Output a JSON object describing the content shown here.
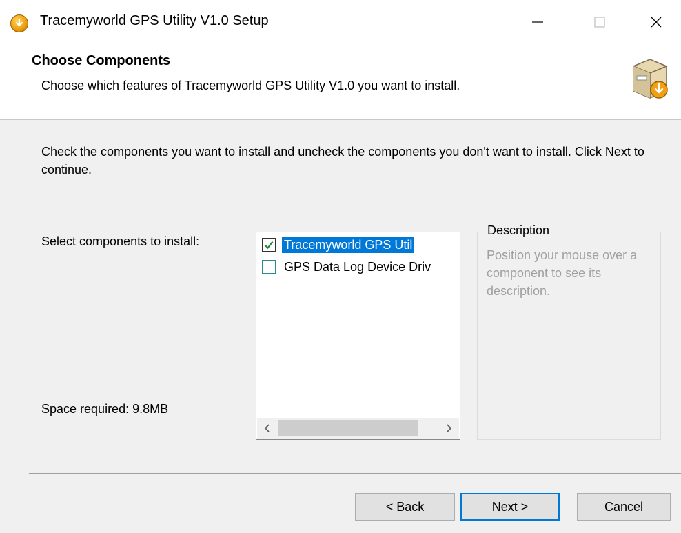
{
  "window": {
    "title": "Tracemyworld GPS Utility V1.0 Setup",
    "icon": "installer-icon",
    "controls": {
      "minimize": "minimize-icon",
      "maximize": "maximize-icon",
      "close": "close-icon"
    }
  },
  "header": {
    "title": "Choose Components",
    "subtitle": "Choose which features of Tracemyworld GPS Utility V1.0 you want to install.",
    "icon": "install-box-icon"
  },
  "body": {
    "instructions": "Check the components you want to install and uncheck the components you don't want to install. Click Next to continue.",
    "select_label": "Select components to install:",
    "space_required": "Space required: 9.8MB"
  },
  "components": [
    {
      "label": "Tracemyworld GPS Util",
      "checked": true,
      "selected": true
    },
    {
      "label": "GPS Data Log Device Driv",
      "checked": false,
      "selected": false
    }
  ],
  "scrollbar": {
    "left_arrow": "chevron-left-icon",
    "right_arrow": "chevron-right-icon"
  },
  "description": {
    "legend": "Description",
    "text": "Position your mouse over a component to see its description."
  },
  "buttons": {
    "back": "< Back",
    "next": "Next >",
    "cancel": "Cancel"
  },
  "colors": {
    "selection": "#0078d7",
    "default_button_border": "#0078d7",
    "description_text": "#a0a0a0"
  }
}
